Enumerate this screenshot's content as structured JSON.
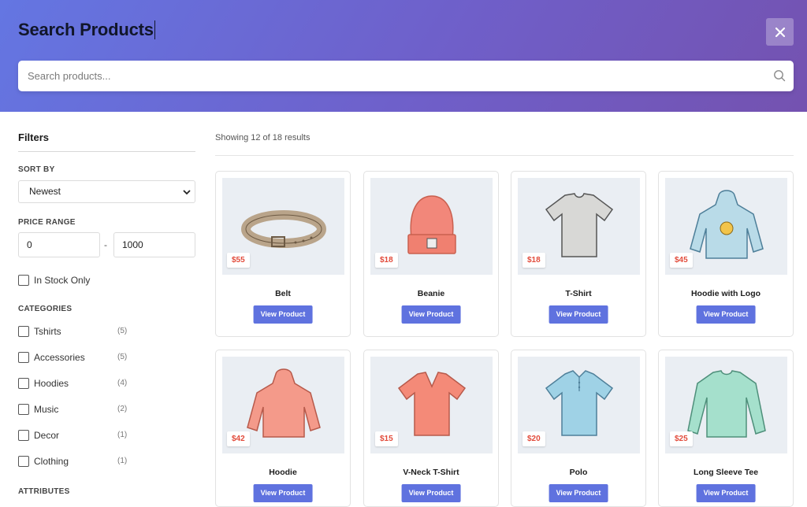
{
  "header": {
    "title": "Search Products",
    "search_placeholder": "Search products..."
  },
  "sidebar": {
    "filters_title": "Filters",
    "sort_label": "SORT BY",
    "sort_value": "Newest",
    "price_label": "PRICE RANGE",
    "price_min": "0",
    "price_dash": "-",
    "price_max": "1000",
    "in_stock_label": "In Stock Only",
    "categories_label": "CATEGORIES",
    "categories": [
      {
        "name": "Tshirts",
        "count": "(5)"
      },
      {
        "name": "Accessories",
        "count": "(5)"
      },
      {
        "name": "Hoodies",
        "count": "(4)"
      },
      {
        "name": "Music",
        "count": "(2)"
      },
      {
        "name": "Decor",
        "count": "(1)"
      },
      {
        "name": "Clothing",
        "count": "(1)"
      }
    ],
    "attributes_label": "ATTRIBUTES"
  },
  "main": {
    "results_text": "Showing 12 of 18 results",
    "view_button_label": "View Product",
    "products": [
      {
        "name": "Belt",
        "price": "$55",
        "image": "belt-image",
        "color": "#b9a48a"
      },
      {
        "name": "Beanie",
        "price": "$18",
        "image": "beanie-image",
        "color": "#f2877a"
      },
      {
        "name": "T-Shirt",
        "price": "$18",
        "image": "tshirt-image",
        "color": "#d8d8d6"
      },
      {
        "name": "Hoodie with Logo",
        "price": "$45",
        "image": "hoodie-logo-image",
        "color": "#b9dbe8"
      },
      {
        "name": "Hoodie",
        "price": "$42",
        "image": "hoodie-image",
        "color": "#f49a8a"
      },
      {
        "name": "V-Neck T-Shirt",
        "price": "$15",
        "image": "vneck-image",
        "color": "#f48a78"
      },
      {
        "name": "Polo",
        "price": "$20",
        "image": "polo-image",
        "color": "#9fd2e6"
      },
      {
        "name": "Long Sleeve Tee",
        "price": "$25",
        "image": "longsleeve-image",
        "color": "#a5e0cc"
      }
    ]
  },
  "colors": {
    "accent": "#5f72df",
    "price": "#e24b3b",
    "header_gradient_start": "#6476e2",
    "header_gradient_end": "#7452b0"
  }
}
